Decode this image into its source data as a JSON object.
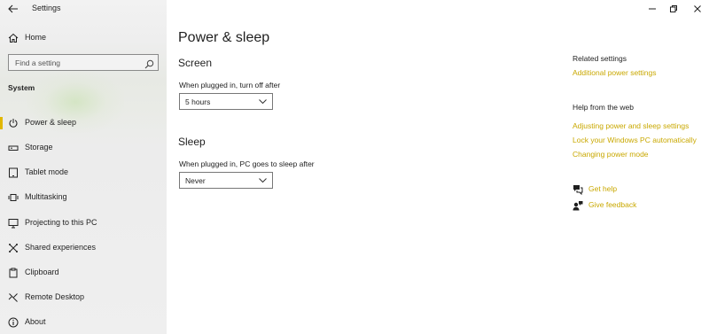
{
  "window": {
    "title": "Settings",
    "controls": [
      "minimize-icon",
      "restore-icon",
      "close-icon"
    ]
  },
  "nav": {
    "home_label": "Home",
    "search_placeholder": "Find a setting",
    "section_label": "System",
    "items": [
      {
        "label": "Power & sleep",
        "icon": "power-icon",
        "selected": true
      },
      {
        "label": "Storage",
        "icon": "storage-icon"
      },
      {
        "label": "Tablet mode",
        "icon": "tablet-icon"
      },
      {
        "label": "Multitasking",
        "icon": "multitasking-icon"
      },
      {
        "label": "Projecting to this PC",
        "icon": "projecting-icon"
      },
      {
        "label": "Shared experiences",
        "icon": "shared-experiences-icon"
      },
      {
        "label": "Clipboard",
        "icon": "clipboard-icon"
      },
      {
        "label": "Remote Desktop",
        "icon": "remote-desktop-icon"
      },
      {
        "label": "About",
        "icon": "info-icon"
      }
    ]
  },
  "main": {
    "title": "Power & sleep",
    "screen": {
      "heading": "Screen",
      "label": "When plugged in, turn off after",
      "value": "5 hours"
    },
    "sleep": {
      "heading": "Sleep",
      "label": "When plugged in, PC goes to sleep after",
      "value": "Never"
    }
  },
  "related": {
    "heading": "Related settings",
    "links": [
      "Additional power settings"
    ]
  },
  "help": {
    "heading": "Help from the web",
    "links": [
      "Adjusting power and sleep settings",
      "Lock your Windows PC automatically",
      "Changing power mode"
    ],
    "get_help": "Get help",
    "give_feedback": "Give feedback"
  },
  "colors": {
    "accent": "#c9a800",
    "selection_bar": "#e1b700",
    "nav_background": "#eeeeee"
  }
}
